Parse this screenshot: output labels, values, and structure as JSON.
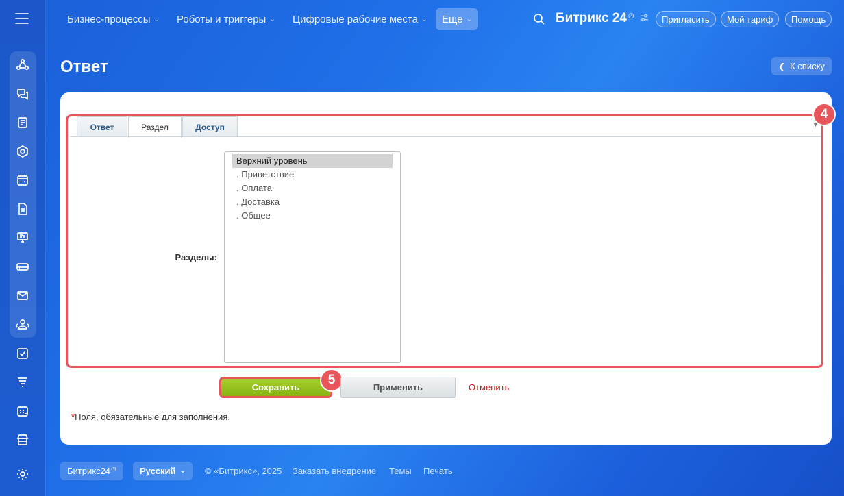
{
  "topnav": {
    "items": [
      {
        "label": "Бизнес-процессы"
      },
      {
        "label": "Роботы и триггеры"
      },
      {
        "label": "Цифровые рабочие места"
      }
    ],
    "more_label": "Еще",
    "brand": "Битрикс",
    "brand_number": "24",
    "invite_label": "Пригласить",
    "tariff_label": "Мой тариф",
    "help_label": "Помощь"
  },
  "page": {
    "title": "Ответ",
    "back_label": "К списку"
  },
  "tabs": [
    {
      "label": "Ответ",
      "active": false
    },
    {
      "label": "Раздел",
      "active": true
    },
    {
      "label": "Доступ",
      "active": false
    }
  ],
  "form": {
    "sections_label": "Разделы:",
    "options": [
      {
        "label": "Верхний уровень",
        "selected": true
      },
      {
        "label": ". Приветствие",
        "selected": false
      },
      {
        "label": ". Оплата",
        "selected": false
      },
      {
        "label": ". Доставка",
        "selected": false
      },
      {
        "label": ". Общее",
        "selected": false
      }
    ],
    "save_label": "Сохранить",
    "apply_label": "Применить",
    "cancel_label": "Отменить",
    "required_star": "*",
    "required_note": "Поля, обязательные для заполнения."
  },
  "annotations": {
    "badge_tabs": "4",
    "badge_save": "5",
    "color": "#e8555a"
  },
  "footer": {
    "brand": "Битрикс24",
    "language": "Русский",
    "copyright": "© «Битрикс», 2025",
    "order_link": "Заказать внедрение",
    "themes_link": "Темы",
    "print_link": "Печать"
  },
  "icons": [
    "menu-icon",
    "automation-icon",
    "chat-icon",
    "tasks-doc-icon",
    "hexagon-icon",
    "calendar-icon",
    "document-icon",
    "presentation-icon",
    "drive-icon",
    "mail-icon",
    "users-icon",
    "checkbox-icon",
    "filter-icon",
    "planner-icon",
    "store-icon",
    "gear-icon",
    "search-icon",
    "settings-sliders-icon",
    "chevron-down-icon",
    "chevron-left-icon"
  ]
}
